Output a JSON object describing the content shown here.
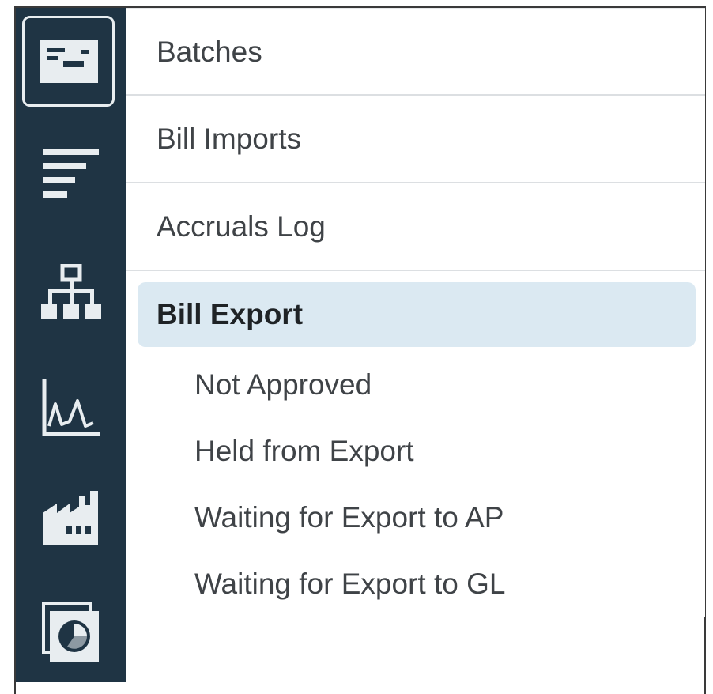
{
  "rail": {
    "icons": [
      {
        "name": "batches-card-icon",
        "active": true
      },
      {
        "name": "filter-lines-icon",
        "active": false
      },
      {
        "name": "org-hierarchy-icon",
        "active": false
      },
      {
        "name": "line-chart-icon",
        "active": false
      },
      {
        "name": "factory-icon",
        "active": false
      },
      {
        "name": "pie-report-icon",
        "active": false
      }
    ]
  },
  "menu": {
    "items": [
      {
        "label": "Batches"
      },
      {
        "label": "Bill Imports"
      },
      {
        "label": "Accruals Log"
      }
    ],
    "section": {
      "label": "Bill Export",
      "items": [
        {
          "label": "Not Approved"
        },
        {
          "label": "Held from Export"
        },
        {
          "label": "Waiting for Export to AP"
        },
        {
          "label": "Waiting for Export to GL"
        }
      ]
    }
  },
  "colors": {
    "rail_bg": "#1f3444",
    "icon": "#e8edf0",
    "selected_bg": "#dbe9f2",
    "text": "#3f4347"
  }
}
